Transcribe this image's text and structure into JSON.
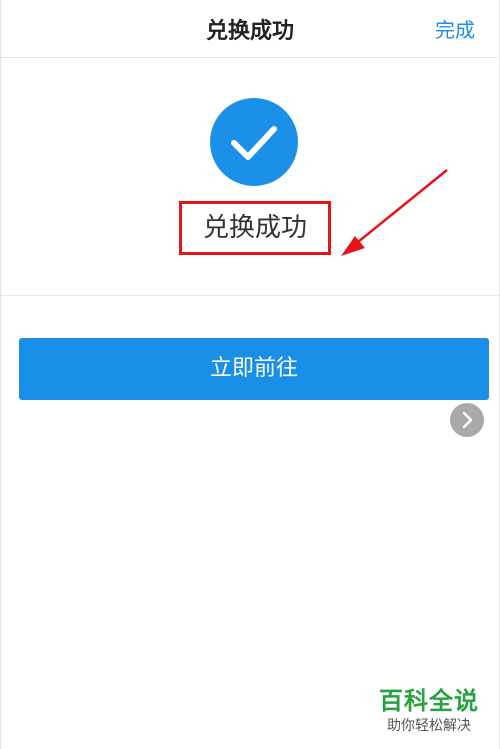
{
  "nav": {
    "title": "兑换成功",
    "done_label": "完成"
  },
  "result": {
    "status_text": "兑换成功",
    "icon": "checkmark-icon"
  },
  "actions": {
    "go_label": "立即前往",
    "next_icon": "chevron-right-icon"
  },
  "watermark": {
    "title": "百科全说",
    "subtitle": "助你轻松解决"
  },
  "colors": {
    "accent": "#1a90e8",
    "annotation": "#e5141b",
    "watermark_green": "#26a33f"
  }
}
